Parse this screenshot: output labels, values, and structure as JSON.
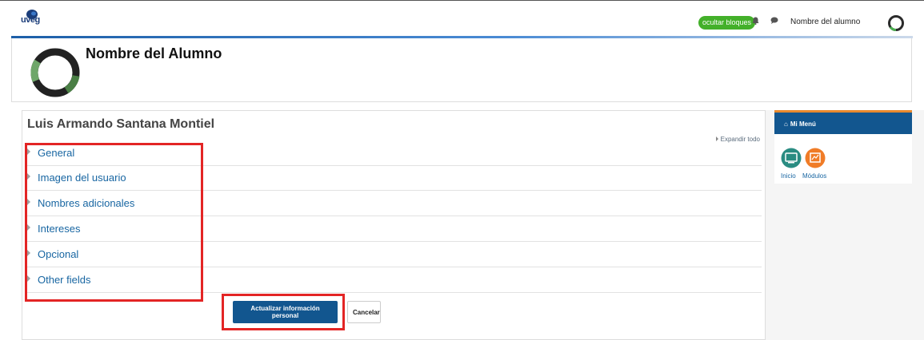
{
  "navbar": {
    "logo_text": "uveg",
    "hide_blocks_label": "ocultar bloques",
    "bell_icon": "bell-icon",
    "chat_icon": "chat-icon",
    "username": "Nombre del alumno"
  },
  "header": {
    "title": "Nombre del Alumno"
  },
  "profile": {
    "fullname": "Luis Armando Santana Montiel",
    "expand_all": "Expandir todo",
    "sections": [
      {
        "label": "General"
      },
      {
        "label": "Imagen del usuario"
      },
      {
        "label": "Nombres adicionales"
      },
      {
        "label": "Intereses"
      },
      {
        "label": "Opcional"
      },
      {
        "label": "Other fields"
      }
    ],
    "submit_label": "Actualizar información personal",
    "cancel_label": "Cancelar"
  },
  "sidebar": {
    "block_title": "Mi Menú",
    "items": [
      {
        "label": "Inicio",
        "icon": "monitor-icon"
      },
      {
        "label": "Módulos",
        "icon": "modules-icon"
      }
    ]
  },
  "colors": {
    "primary": "#12568f",
    "accent": "#43b02a",
    "highlight": "#e32525",
    "link": "#1866a2",
    "block_top": "#e8892e"
  }
}
